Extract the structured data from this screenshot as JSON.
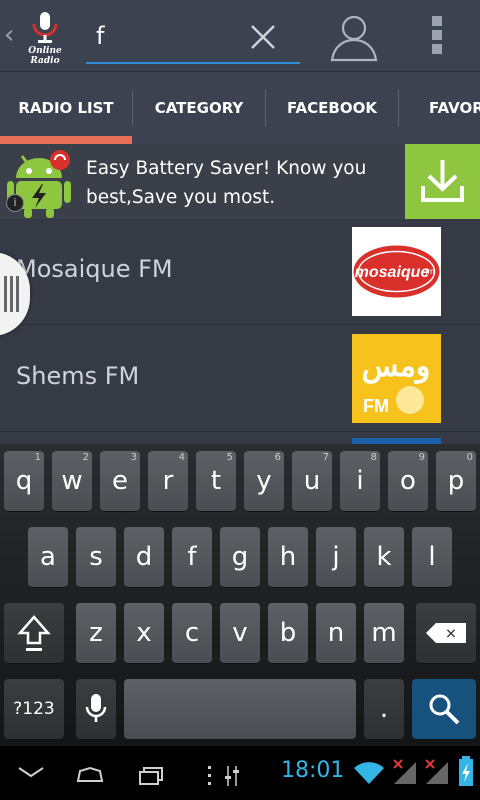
{
  "app": {
    "logo_text": "Online Radio"
  },
  "search": {
    "value": "f",
    "placeholder": ""
  },
  "tabs": [
    {
      "label": "RADIO LIST",
      "active": true
    },
    {
      "label": "CATEGORY",
      "active": false
    },
    {
      "label": "FACEBOOK",
      "active": false
    },
    {
      "label": "FAVORI",
      "active": false
    }
  ],
  "ad": {
    "text": "Easy Battery Saver! Know you best,Save you most.",
    "info_label": "i"
  },
  "stations": [
    {
      "name": "Mosaique FM",
      "logo_text": "mosaique",
      "logo_subtext": "fm"
    },
    {
      "name": "Shems FM",
      "logo_text": "ومس",
      "logo_subtext": "FM"
    }
  ],
  "keyboard": {
    "row1": [
      {
        "key": "q",
        "hint": "1"
      },
      {
        "key": "w",
        "hint": "2"
      },
      {
        "key": "e",
        "hint": "3"
      },
      {
        "key": "r",
        "hint": "4"
      },
      {
        "key": "t",
        "hint": "5"
      },
      {
        "key": "y",
        "hint": "6"
      },
      {
        "key": "u",
        "hint": "7"
      },
      {
        "key": "i",
        "hint": "8"
      },
      {
        "key": "o",
        "hint": "9"
      },
      {
        "key": "p",
        "hint": "0"
      }
    ],
    "row2": [
      "a",
      "s",
      "d",
      "f",
      "g",
      "h",
      "j",
      "k",
      "l"
    ],
    "row3": [
      "z",
      "x",
      "c",
      "v",
      "b",
      "n",
      "m"
    ],
    "symbols_label": "?123",
    "period_label": ".",
    "delete_label": "✕"
  },
  "status": {
    "time": "18:01"
  },
  "colors": {
    "accent_blue": "#2f8fd6",
    "tab_indicator": "#e8705a",
    "ad_download": "#8ec63f",
    "clock": "#33b5e5"
  }
}
